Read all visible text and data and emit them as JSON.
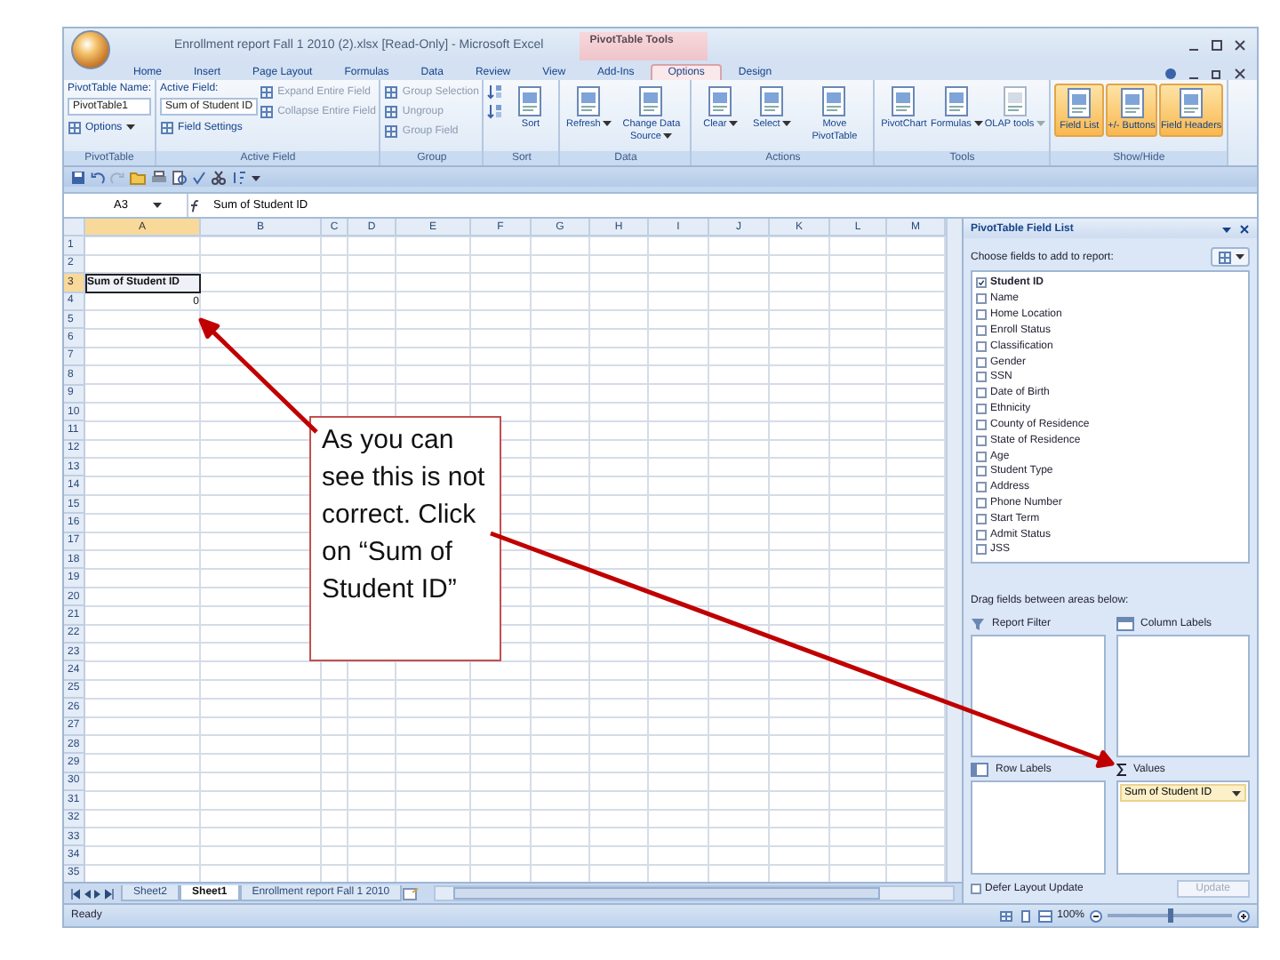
{
  "title_bar": {
    "title": "Enrollment report Fall 1 2010 (2).xlsx  [Read-Only] - Microsoft Excel",
    "contextual_tab": "PivotTable Tools"
  },
  "ribbon_tabs": [
    {
      "label": "Home",
      "selected": false
    },
    {
      "label": "Insert",
      "selected": false
    },
    {
      "label": "Page Layout",
      "selected": false
    },
    {
      "label": "Formulas",
      "selected": false
    },
    {
      "label": "Data",
      "selected": false
    },
    {
      "label": "Review",
      "selected": false
    },
    {
      "label": "View",
      "selected": false
    },
    {
      "label": "Add-Ins",
      "selected": false
    },
    {
      "label": "Options",
      "selected": true
    },
    {
      "label": "Design",
      "selected": false
    }
  ],
  "ribbon_groups": [
    {
      "label": "PivotTable",
      "columns": [
        [
          {
            "kind": "caption",
            "text": "PivotTable Name:"
          },
          {
            "kind": "field",
            "text": "PivotTable1"
          },
          {
            "kind": "small",
            "text": "Options",
            "disabled": false,
            "dropdown": true
          }
        ]
      ]
    },
    {
      "label": "Active Field",
      "columns": [
        [
          {
            "kind": "caption",
            "text": "Active Field:"
          },
          {
            "kind": "field",
            "text": "Sum of Student ID"
          },
          {
            "kind": "small",
            "text": "Field Settings",
            "disabled": false,
            "dropdown": false
          }
        ],
        [
          {
            "kind": "small",
            "text": "Expand Entire Field",
            "disabled": true,
            "dropdown": false
          },
          {
            "kind": "small",
            "text": "Collapse Entire Field",
            "disabled": true,
            "dropdown": false
          }
        ]
      ]
    },
    {
      "label": "Group",
      "columns": [
        [
          {
            "kind": "small",
            "text": "Group Selection",
            "disabled": true,
            "dropdown": false
          },
          {
            "kind": "small",
            "text": "Ungroup",
            "disabled": true,
            "dropdown": false
          },
          {
            "kind": "small",
            "text": "Group Field",
            "disabled": true,
            "dropdown": false
          }
        ]
      ]
    },
    {
      "label": "Sort",
      "columns": [
        [
          {
            "kind": "icon",
            "disabled": false
          },
          {
            "kind": "icon",
            "disabled": false
          }
        ],
        [
          {
            "kind": "large",
            "text": "Sort",
            "disabled": false,
            "dropdown": false
          }
        ]
      ]
    },
    {
      "label": "Data",
      "columns": [
        [
          {
            "kind": "large",
            "text": "Refresh",
            "disabled": false,
            "dropdown": true
          }
        ],
        [
          {
            "kind": "large",
            "text": "Change Data Source",
            "disabled": false,
            "dropdown": true
          }
        ]
      ]
    },
    {
      "label": "Actions",
      "columns": [
        [
          {
            "kind": "large",
            "text": "Clear",
            "disabled": false,
            "dropdown": true
          }
        ],
        [
          {
            "kind": "large",
            "text": "Select",
            "disabled": false,
            "dropdown": true
          }
        ],
        [
          {
            "kind": "large",
            "text": "Move PivotTable",
            "disabled": false,
            "dropdown": false
          }
        ]
      ]
    },
    {
      "label": "Tools",
      "columns": [
        [
          {
            "kind": "large",
            "text": "PivotChart",
            "disabled": false,
            "dropdown": false
          }
        ],
        [
          {
            "kind": "large",
            "text": "Formulas",
            "disabled": false,
            "dropdown": true
          }
        ],
        [
          {
            "kind": "large",
            "text": "OLAP tools",
            "disabled": true,
            "dropdown": true
          }
        ]
      ]
    },
    {
      "label": "Show/Hide",
      "columns": [
        [
          {
            "kind": "toggle",
            "text": "Field List",
            "disabled": false,
            "dropdown": false,
            "selected": true
          }
        ],
        [
          {
            "kind": "toggle",
            "text": "+/- Buttons",
            "disabled": false,
            "dropdown": false,
            "selected": true
          }
        ],
        [
          {
            "kind": "toggle",
            "text": "Field Headers",
            "disabled": false,
            "dropdown": false,
            "selected": true
          }
        ]
      ]
    }
  ],
  "formula_bar": {
    "name_box": "A3",
    "formula": "Sum of Student ID"
  },
  "sheet": {
    "columns": [
      {
        "label": "A",
        "selected": true
      },
      {
        "label": "B",
        "selected": false
      },
      {
        "label": "C",
        "selected": false
      },
      {
        "label": "D",
        "selected": false
      },
      {
        "label": "E",
        "selected": false
      },
      {
        "label": "F",
        "selected": false
      },
      {
        "label": "G",
        "selected": false
      },
      {
        "label": "H",
        "selected": false
      },
      {
        "label": "I",
        "selected": false
      },
      {
        "label": "J",
        "selected": false
      },
      {
        "label": "K",
        "selected": false
      },
      {
        "label": "L",
        "selected": false
      },
      {
        "label": "M",
        "selected": false
      }
    ],
    "rows": [
      {
        "label": "1",
        "selected": false
      },
      {
        "label": "2",
        "selected": false
      },
      {
        "label": "3",
        "selected": true,
        "cells": [
          {
            "text": "Sum of Student ID",
            "kind": "label",
            "selected": true
          }
        ]
      },
      {
        "label": "4",
        "selected": false,
        "cells": [
          {
            "text": "0",
            "kind": "number",
            "selected": false
          }
        ]
      },
      {
        "label": "5",
        "selected": false
      },
      {
        "label": "6",
        "selected": false
      },
      {
        "label": "7",
        "selected": false
      },
      {
        "label": "8",
        "selected": false
      },
      {
        "label": "9",
        "selected": false
      },
      {
        "label": "10",
        "selected": false
      },
      {
        "label": "11",
        "selected": false
      },
      {
        "label": "12",
        "selected": false
      },
      {
        "label": "13",
        "selected": false
      },
      {
        "label": "14",
        "selected": false
      },
      {
        "label": "15",
        "selected": false
      },
      {
        "label": "16",
        "selected": false
      },
      {
        "label": "17",
        "selected": false
      },
      {
        "label": "18",
        "selected": false
      },
      {
        "label": "19",
        "selected": false
      },
      {
        "label": "20",
        "selected": false
      },
      {
        "label": "21",
        "selected": false
      },
      {
        "label": "22",
        "selected": false
      },
      {
        "label": "23",
        "selected": false
      },
      {
        "label": "24",
        "selected": false
      },
      {
        "label": "25",
        "selected": false
      },
      {
        "label": "26",
        "selected": false
      },
      {
        "label": "27",
        "selected": false
      },
      {
        "label": "28",
        "selected": false
      },
      {
        "label": "29",
        "selected": false
      },
      {
        "label": "30",
        "selected": false
      },
      {
        "label": "31",
        "selected": false
      },
      {
        "label": "32",
        "selected": false
      },
      {
        "label": "33",
        "selected": false
      },
      {
        "label": "34",
        "selected": false
      },
      {
        "label": "35",
        "selected": false
      }
    ]
  },
  "sheet_tabs": [
    {
      "label": "Sheet2",
      "selected": false
    },
    {
      "label": "Sheet1",
      "selected": true
    },
    {
      "label": "Enrollment report Fall 1 2010",
      "selected": false
    }
  ],
  "field_list": {
    "title": "PivotTable Field List",
    "prompt": "Choose fields to add to report:",
    "fields": [
      {
        "label": "Student ID",
        "checked": true
      },
      {
        "label": "Name",
        "checked": false
      },
      {
        "label": "Home Location",
        "checked": false
      },
      {
        "label": "Enroll Status",
        "checked": false
      },
      {
        "label": "Classification",
        "checked": false
      },
      {
        "label": "Gender",
        "checked": false
      },
      {
        "label": "SSN",
        "checked": false
      },
      {
        "label": "Date of Birth",
        "checked": false
      },
      {
        "label": "Ethnicity",
        "checked": false
      },
      {
        "label": "County of Residence",
        "checked": false
      },
      {
        "label": "State of Residence",
        "checked": false
      },
      {
        "label": "Age",
        "checked": false
      },
      {
        "label": "Student Type",
        "checked": false
      },
      {
        "label": "Address",
        "checked": false
      },
      {
        "label": "Phone Number",
        "checked": false
      },
      {
        "label": "Start Term",
        "checked": false
      },
      {
        "label": "Admit Status",
        "checked": false
      },
      {
        "label": "JSS",
        "checked": false
      }
    ],
    "areas_prompt": "Drag fields between areas below:",
    "areas": [
      {
        "kind": "filter",
        "label": "Report Filter"
      },
      {
        "kind": "columns",
        "label": "Column Labels"
      },
      {
        "kind": "rows",
        "label": "Row Labels"
      },
      {
        "kind": "values",
        "label": "Values",
        "items": [
          "Sum of Student ID"
        ]
      }
    ],
    "defer": {
      "label": "Defer Layout Update",
      "checked": false
    },
    "update_button": {
      "label": "Update",
      "disabled": true
    }
  },
  "status_bar": {
    "status": "Ready",
    "zoom": "100%",
    "zoom_slider": {
      "level": 0.5
    }
  },
  "callout": {
    "text": "As you can see this is not correct. Click on “Sum of Student ID”"
  }
}
